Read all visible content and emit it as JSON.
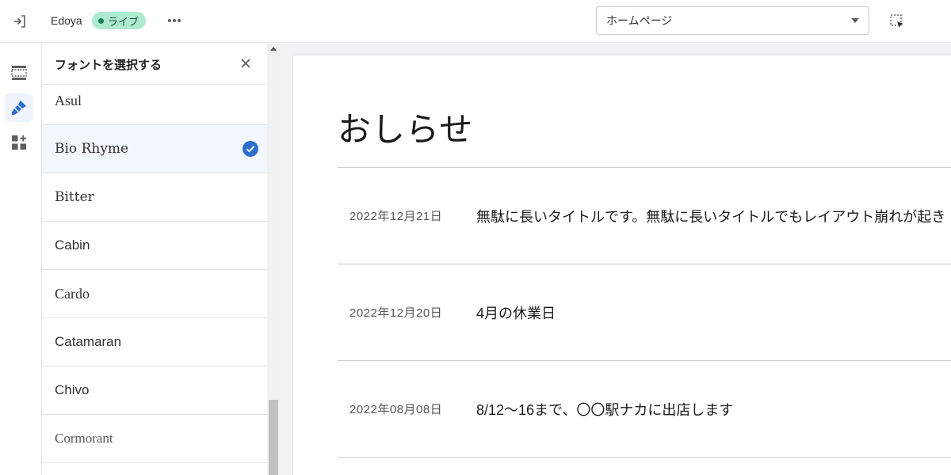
{
  "topbar": {
    "store_name": "Edoya",
    "live_label": "ライブ",
    "page_select_value": "ホームページ"
  },
  "icons": {
    "exit": "exit-icon",
    "more": "more-horizontal-icon",
    "caret": "caret-down-icon",
    "inspector": "select-element-icon",
    "sections": "sections-icon",
    "theme_settings": "paint-brush-icon",
    "apps": "apps-icon",
    "close": "close-icon",
    "check": "check-circle-icon"
  },
  "colors": {
    "accent": "#2c6ecb",
    "live_badge_bg": "#aee9d1",
    "live_badge_text": "#0d5c3a"
  },
  "font_panel": {
    "title": "フォントを選択する",
    "fonts": [
      {
        "label": "Asul"
      },
      {
        "label": "Bio Rhyme",
        "selected": true
      },
      {
        "label": "Bitter"
      },
      {
        "label": "Cabin"
      },
      {
        "label": "Cardo"
      },
      {
        "label": "Catamaran"
      },
      {
        "label": "Chivo"
      },
      {
        "label": "Cormorant"
      }
    ]
  },
  "preview": {
    "heading": "おしらせ",
    "news": [
      {
        "date": "2022年12月21日",
        "title": "無駄に長いタイトルです。無駄に長いタイトルでもレイアウト崩れが起き"
      },
      {
        "date": "2022年12月20日",
        "title": "4月の休業日"
      },
      {
        "date": "2022年08月08日",
        "title": "8/12～16まで、〇〇駅ナカに出店します"
      }
    ]
  }
}
